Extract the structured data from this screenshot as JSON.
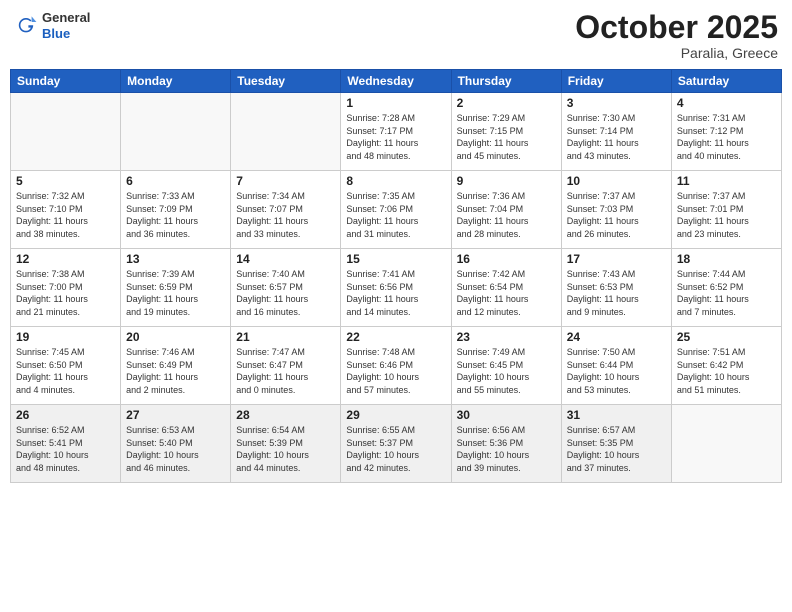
{
  "header": {
    "logo_general": "General",
    "logo_blue": "Blue",
    "month": "October 2025",
    "location": "Paralia, Greece"
  },
  "days_of_week": [
    "Sunday",
    "Monday",
    "Tuesday",
    "Wednesday",
    "Thursday",
    "Friday",
    "Saturday"
  ],
  "weeks": [
    [
      {
        "day": "",
        "info": "",
        "empty": true
      },
      {
        "day": "",
        "info": "",
        "empty": true
      },
      {
        "day": "",
        "info": "",
        "empty": true
      },
      {
        "day": "1",
        "info": "Sunrise: 7:28 AM\nSunset: 7:17 PM\nDaylight: 11 hours\nand 48 minutes.",
        "empty": false
      },
      {
        "day": "2",
        "info": "Sunrise: 7:29 AM\nSunset: 7:15 PM\nDaylight: 11 hours\nand 45 minutes.",
        "empty": false
      },
      {
        "day": "3",
        "info": "Sunrise: 7:30 AM\nSunset: 7:14 PM\nDaylight: 11 hours\nand 43 minutes.",
        "empty": false
      },
      {
        "day": "4",
        "info": "Sunrise: 7:31 AM\nSunset: 7:12 PM\nDaylight: 11 hours\nand 40 minutes.",
        "empty": false
      }
    ],
    [
      {
        "day": "5",
        "info": "Sunrise: 7:32 AM\nSunset: 7:10 PM\nDaylight: 11 hours\nand 38 minutes.",
        "empty": false
      },
      {
        "day": "6",
        "info": "Sunrise: 7:33 AM\nSunset: 7:09 PM\nDaylight: 11 hours\nand 36 minutes.",
        "empty": false
      },
      {
        "day": "7",
        "info": "Sunrise: 7:34 AM\nSunset: 7:07 PM\nDaylight: 11 hours\nand 33 minutes.",
        "empty": false
      },
      {
        "day": "8",
        "info": "Sunrise: 7:35 AM\nSunset: 7:06 PM\nDaylight: 11 hours\nand 31 minutes.",
        "empty": false
      },
      {
        "day": "9",
        "info": "Sunrise: 7:36 AM\nSunset: 7:04 PM\nDaylight: 11 hours\nand 28 minutes.",
        "empty": false
      },
      {
        "day": "10",
        "info": "Sunrise: 7:37 AM\nSunset: 7:03 PM\nDaylight: 11 hours\nand 26 minutes.",
        "empty": false
      },
      {
        "day": "11",
        "info": "Sunrise: 7:37 AM\nSunset: 7:01 PM\nDaylight: 11 hours\nand 23 minutes.",
        "empty": false
      }
    ],
    [
      {
        "day": "12",
        "info": "Sunrise: 7:38 AM\nSunset: 7:00 PM\nDaylight: 11 hours\nand 21 minutes.",
        "empty": false
      },
      {
        "day": "13",
        "info": "Sunrise: 7:39 AM\nSunset: 6:59 PM\nDaylight: 11 hours\nand 19 minutes.",
        "empty": false
      },
      {
        "day": "14",
        "info": "Sunrise: 7:40 AM\nSunset: 6:57 PM\nDaylight: 11 hours\nand 16 minutes.",
        "empty": false
      },
      {
        "day": "15",
        "info": "Sunrise: 7:41 AM\nSunset: 6:56 PM\nDaylight: 11 hours\nand 14 minutes.",
        "empty": false
      },
      {
        "day": "16",
        "info": "Sunrise: 7:42 AM\nSunset: 6:54 PM\nDaylight: 11 hours\nand 12 minutes.",
        "empty": false
      },
      {
        "day": "17",
        "info": "Sunrise: 7:43 AM\nSunset: 6:53 PM\nDaylight: 11 hours\nand 9 minutes.",
        "empty": false
      },
      {
        "day": "18",
        "info": "Sunrise: 7:44 AM\nSunset: 6:52 PM\nDaylight: 11 hours\nand 7 minutes.",
        "empty": false
      }
    ],
    [
      {
        "day": "19",
        "info": "Sunrise: 7:45 AM\nSunset: 6:50 PM\nDaylight: 11 hours\nand 4 minutes.",
        "empty": false
      },
      {
        "day": "20",
        "info": "Sunrise: 7:46 AM\nSunset: 6:49 PM\nDaylight: 11 hours\nand 2 minutes.",
        "empty": false
      },
      {
        "day": "21",
        "info": "Sunrise: 7:47 AM\nSunset: 6:47 PM\nDaylight: 11 hours\nand 0 minutes.",
        "empty": false
      },
      {
        "day": "22",
        "info": "Sunrise: 7:48 AM\nSunset: 6:46 PM\nDaylight: 10 hours\nand 57 minutes.",
        "empty": false
      },
      {
        "day": "23",
        "info": "Sunrise: 7:49 AM\nSunset: 6:45 PM\nDaylight: 10 hours\nand 55 minutes.",
        "empty": false
      },
      {
        "day": "24",
        "info": "Sunrise: 7:50 AM\nSunset: 6:44 PM\nDaylight: 10 hours\nand 53 minutes.",
        "empty": false
      },
      {
        "day": "25",
        "info": "Sunrise: 7:51 AM\nSunset: 6:42 PM\nDaylight: 10 hours\nand 51 minutes.",
        "empty": false
      }
    ],
    [
      {
        "day": "26",
        "info": "Sunrise: 6:52 AM\nSunset: 5:41 PM\nDaylight: 10 hours\nand 48 minutes.",
        "empty": false
      },
      {
        "day": "27",
        "info": "Sunrise: 6:53 AM\nSunset: 5:40 PM\nDaylight: 10 hours\nand 46 minutes.",
        "empty": false
      },
      {
        "day": "28",
        "info": "Sunrise: 6:54 AM\nSunset: 5:39 PM\nDaylight: 10 hours\nand 44 minutes.",
        "empty": false
      },
      {
        "day": "29",
        "info": "Sunrise: 6:55 AM\nSunset: 5:37 PM\nDaylight: 10 hours\nand 42 minutes.",
        "empty": false
      },
      {
        "day": "30",
        "info": "Sunrise: 6:56 AM\nSunset: 5:36 PM\nDaylight: 10 hours\nand 39 minutes.",
        "empty": false
      },
      {
        "day": "31",
        "info": "Sunrise: 6:57 AM\nSunset: 5:35 PM\nDaylight: 10 hours\nand 37 minutes.",
        "empty": false
      },
      {
        "day": "",
        "info": "",
        "empty": true
      }
    ]
  ]
}
